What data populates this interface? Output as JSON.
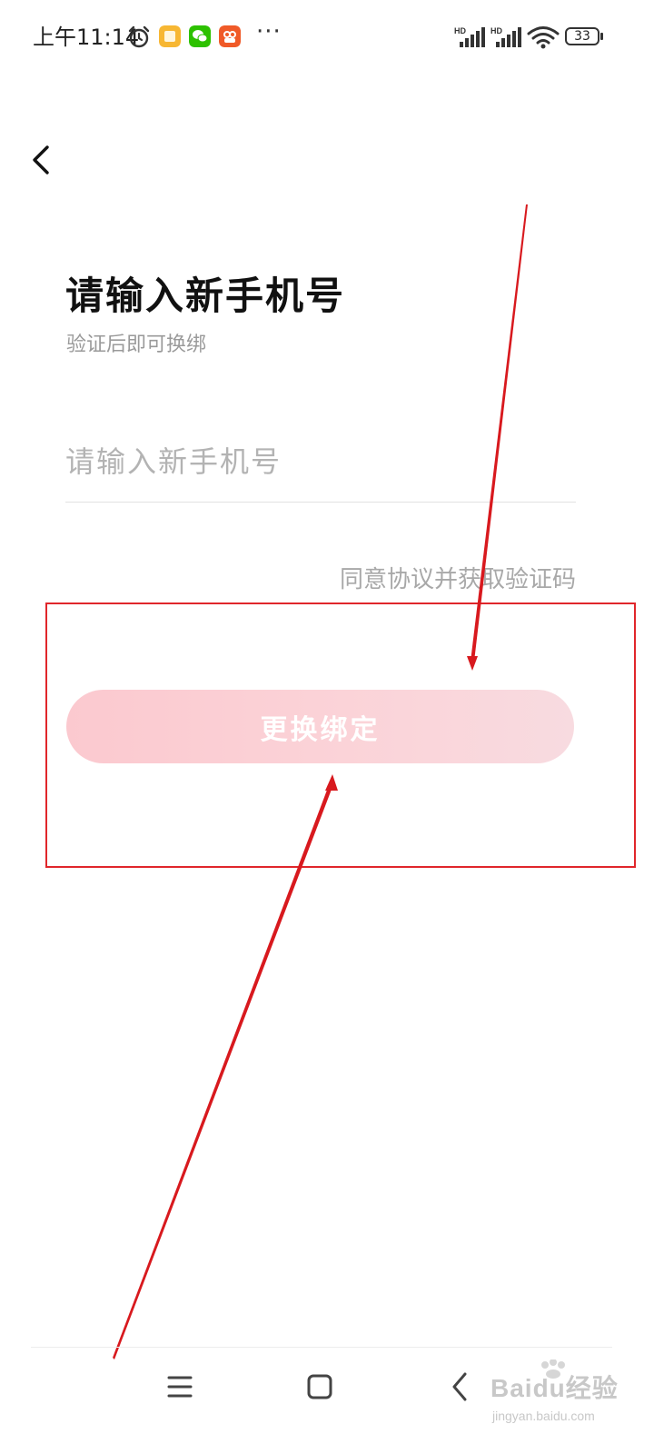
{
  "status_bar": {
    "time": "上午11:14",
    "battery_level": "33",
    "more_indicator": "···",
    "signal_label": "HD",
    "apps": [
      "notes-app-icon",
      "wechat-icon",
      "shopping-app-icon"
    ]
  },
  "page": {
    "title": "请输入新手机号",
    "subtitle": "验证后即可换绑",
    "phone_input_placeholder": "请输入新手机号",
    "phone_input_value": "",
    "get_code_label": "同意协议并获取验证码",
    "rebind_button_label": "更换绑定"
  },
  "watermark": {
    "brand": "Baidu经验",
    "url": "jingyan.baidu.com"
  },
  "colors": {
    "annotation": "#e0262b",
    "button_fill": "#fbcdd2",
    "button_text": "#ffffff",
    "title": "#111111",
    "hint": "#a8a8a8"
  }
}
